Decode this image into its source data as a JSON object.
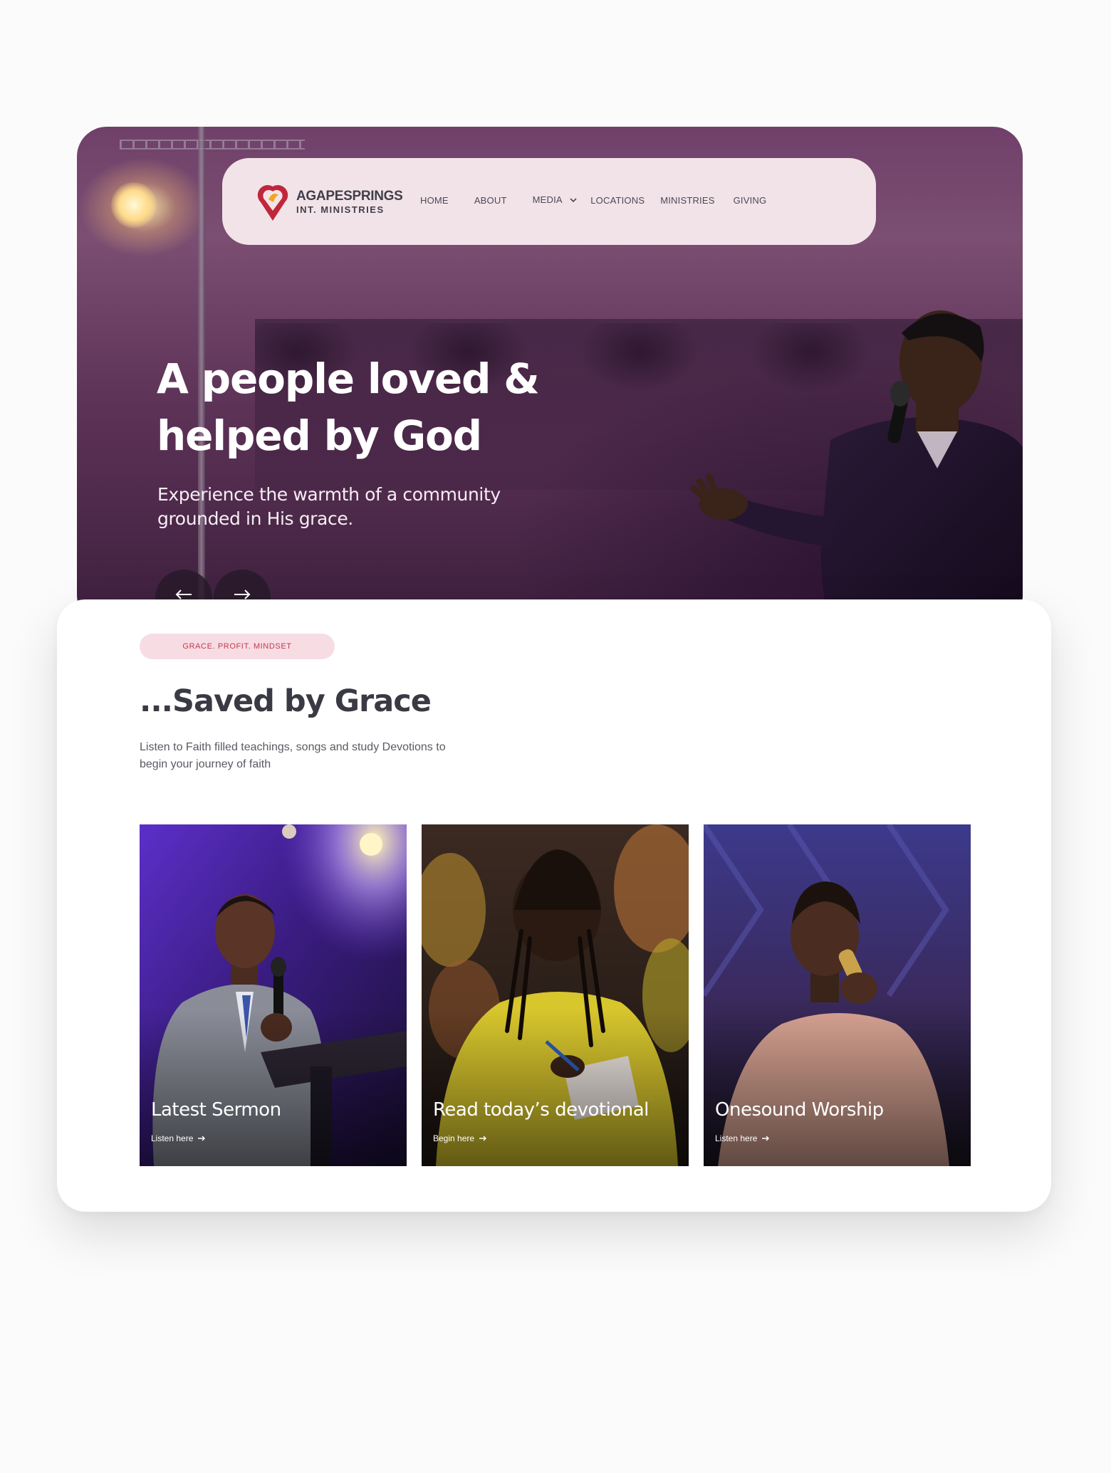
{
  "logo": {
    "line1": "AGAPESPRINGS",
    "line2": "INT. MINISTRIES"
  },
  "nav": {
    "items": [
      {
        "label": "HOME"
      },
      {
        "label": "ABOUT"
      },
      {
        "label": "MEDIA"
      },
      {
        "label": "LOCATIONS"
      },
      {
        "label": "MINISTRIES"
      },
      {
        "label": "GIVING"
      }
    ]
  },
  "hero": {
    "title_line1": "A people loved &",
    "title_line2": "helped by God",
    "subtitle": "Experience the warmth of a community grounded in His grace."
  },
  "section": {
    "tag": "GRACE. PROFIT. MINDSET",
    "title": "...Saved by Grace",
    "description": "Listen to Faith filled teachings, songs and study Devotions to begin your journey of faith"
  },
  "cards": [
    {
      "title": "Latest Sermon",
      "link": "Listen here"
    },
    {
      "title": "Read today’s devotional",
      "link": "Begin here"
    },
    {
      "title": "Onesound Worship",
      "link": "Listen here"
    }
  ],
  "colors": {
    "brand_red": "#c0394f",
    "nav_bg": "#f2e3e8",
    "tag_bg": "#f7dde3",
    "heading": "#3a3a44"
  }
}
